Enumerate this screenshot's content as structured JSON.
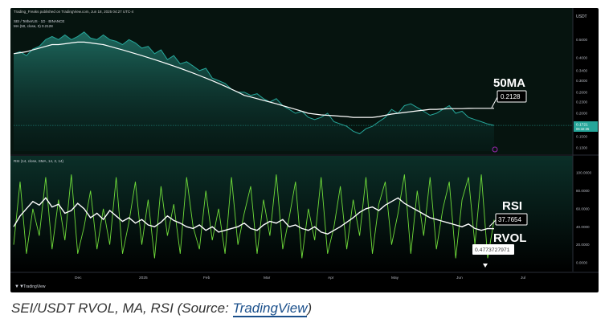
{
  "header": {
    "published": "Trading_Freaks published on TradingView.com, Jun 18, 2025 04:27 UTC-4",
    "symbol_line": "SEI / TetherUS · 1D · BINANCE",
    "ma_line": "MA (50, close, 0) 0.2128"
  },
  "currency": "USDT",
  "labels": {
    "ma": "50MA",
    "rsi": "RSI",
    "rvol": "RVOL"
  },
  "price_badge": {
    "line1": "0.1721",
    "line2": "06:32:35"
  },
  "value_boxes": {
    "ma": "0.2128",
    "rsi": "37.7654",
    "rvol": "0.4773727971"
  },
  "rsi_header": "RSI (14, close, SMA, 14, 2, 14)",
  "brand": "TradingView",
  "caption": {
    "prefix": "SEI/USDT RVOL, MA, RSI (Source: ",
    "link": "TradingView",
    "suffix": ")"
  },
  "colors": {
    "background": "#000000",
    "price_line": "#26a69a",
    "ma_line": "#ffffff",
    "rsi_line": "#ffffff",
    "rvol_line": "#6fdc3a",
    "area_top": "#1f6d62",
    "link": "#1a4f8b"
  },
  "chart_data": [
    {
      "type": "line",
      "title": "SEI / TetherUS · 1D · BINANCE",
      "x_labels": [
        "Dec",
        "2025",
        "Feb",
        "Mar",
        "Apr",
        "May",
        "Jun",
        "Jul"
      ],
      "y_ticks": [
        "0.5000",
        "0.4000",
        "0.3400",
        "0.3000",
        "0.2600",
        "0.2300",
        "0.2000",
        "0.1721",
        "0.1500",
        "0.1300"
      ],
      "y_scale": "log",
      "ylim": [
        0.125,
        0.56
      ],
      "series": [
        {
          "name": "SEI / TetherUS",
          "values": [
            0.42,
            0.43,
            0.41,
            0.445,
            0.46,
            0.5,
            0.52,
            0.5,
            0.53,
            0.5,
            0.52,
            0.55,
            0.51,
            0.5,
            0.53,
            0.5,
            0.49,
            0.47,
            0.5,
            0.48,
            0.45,
            0.46,
            0.42,
            0.44,
            0.39,
            0.41,
            0.37,
            0.38,
            0.36,
            0.34,
            0.35,
            0.31,
            0.3,
            0.29,
            0.27,
            0.26,
            0.26,
            0.25,
            0.255,
            0.24,
            0.23,
            0.24,
            0.22,
            0.21,
            0.2,
            0.205,
            0.19,
            0.185,
            0.19,
            0.2,
            0.18,
            0.175,
            0.17,
            0.16,
            0.155,
            0.165,
            0.17,
            0.18,
            0.19,
            0.21,
            0.2,
            0.22,
            0.225,
            0.215,
            0.205,
            0.195,
            0.2,
            0.21,
            0.22,
            0.2,
            0.205,
            0.19,
            0.185,
            0.18,
            0.175,
            0.172
          ]
        },
        {
          "name": "MA (50, close, 0)",
          "values": [
            0.42,
            0.425,
            0.43,
            0.44,
            0.45,
            0.46,
            0.47,
            0.47,
            0.475,
            0.48,
            0.485,
            0.485,
            0.48,
            0.475,
            0.47,
            0.46,
            0.45,
            0.44,
            0.43,
            0.42,
            0.41,
            0.4,
            0.39,
            0.38,
            0.37,
            0.36,
            0.35,
            0.34,
            0.33,
            0.32,
            0.31,
            0.3,
            0.29,
            0.28,
            0.27,
            0.26,
            0.25,
            0.245,
            0.24,
            0.235,
            0.23,
            0.225,
            0.22,
            0.215,
            0.21,
            0.205,
            0.2,
            0.198,
            0.196,
            0.195,
            0.194,
            0.193,
            0.192,
            0.19,
            0.19,
            0.19,
            0.19,
            0.192,
            0.195,
            0.198,
            0.2,
            0.202,
            0.204,
            0.206,
            0.208,
            0.21,
            0.21,
            0.211,
            0.212,
            0.212,
            0.212,
            0.2125,
            0.2128,
            0.2128,
            0.2128,
            0.2128
          ]
        }
      ]
    },
    {
      "type": "line",
      "title": "RSI (14, close, SMA, 14, 2, 14)",
      "x_labels": [
        "Dec",
        "2025",
        "Feb",
        "Mar",
        "Apr",
        "May",
        "Jun",
        "Jul"
      ],
      "y_ticks": [
        "100.0000",
        "80.0000",
        "60.0000",
        "40.0000",
        "20.0000",
        "0.0000"
      ],
      "ylim": [
        -8,
        108
      ],
      "series": [
        {
          "name": "RSI",
          "values": [
            40,
            52,
            60,
            68,
            64,
            72,
            62,
            65,
            55,
            58,
            66,
            60,
            50,
            55,
            48,
            58,
            52,
            46,
            50,
            44,
            48,
            42,
            40,
            45,
            52,
            47,
            44,
            40,
            38,
            42,
            36,
            40,
            34,
            36,
            38,
            40,
            44,
            38,
            36,
            42,
            46,
            44,
            48,
            40,
            42,
            38,
            36,
            40,
            34,
            32,
            36,
            40,
            45,
            50,
            56,
            60,
            62,
            58,
            64,
            68,
            72,
            66,
            62,
            58,
            54,
            50,
            48,
            46,
            44,
            42,
            40,
            43,
            38,
            36,
            38,
            37.77
          ]
        },
        {
          "name": "RVOL",
          "values": [
            20,
            90,
            10,
            60,
            30,
            95,
            15,
            70,
            25,
            98,
            10,
            40,
            80,
            15,
            60,
            20,
            95,
            10,
            45,
            90,
            20,
            70,
            5,
            85,
            30,
            65,
            10,
            95,
            40,
            15,
            80,
            25,
            60,
            10,
            95,
            20,
            55,
            85,
            10,
            70,
            30,
            98,
            15,
            50,
            90,
            5,
            60,
            25,
            95,
            10,
            40,
            85,
            15,
            70,
            30,
            95,
            10,
            65,
            90,
            20,
            55,
            98,
            10,
            80,
            30,
            95,
            15,
            60,
            90,
            5,
            70,
            95,
            20,
            98,
            5,
            47.74
          ]
        }
      ]
    }
  ]
}
